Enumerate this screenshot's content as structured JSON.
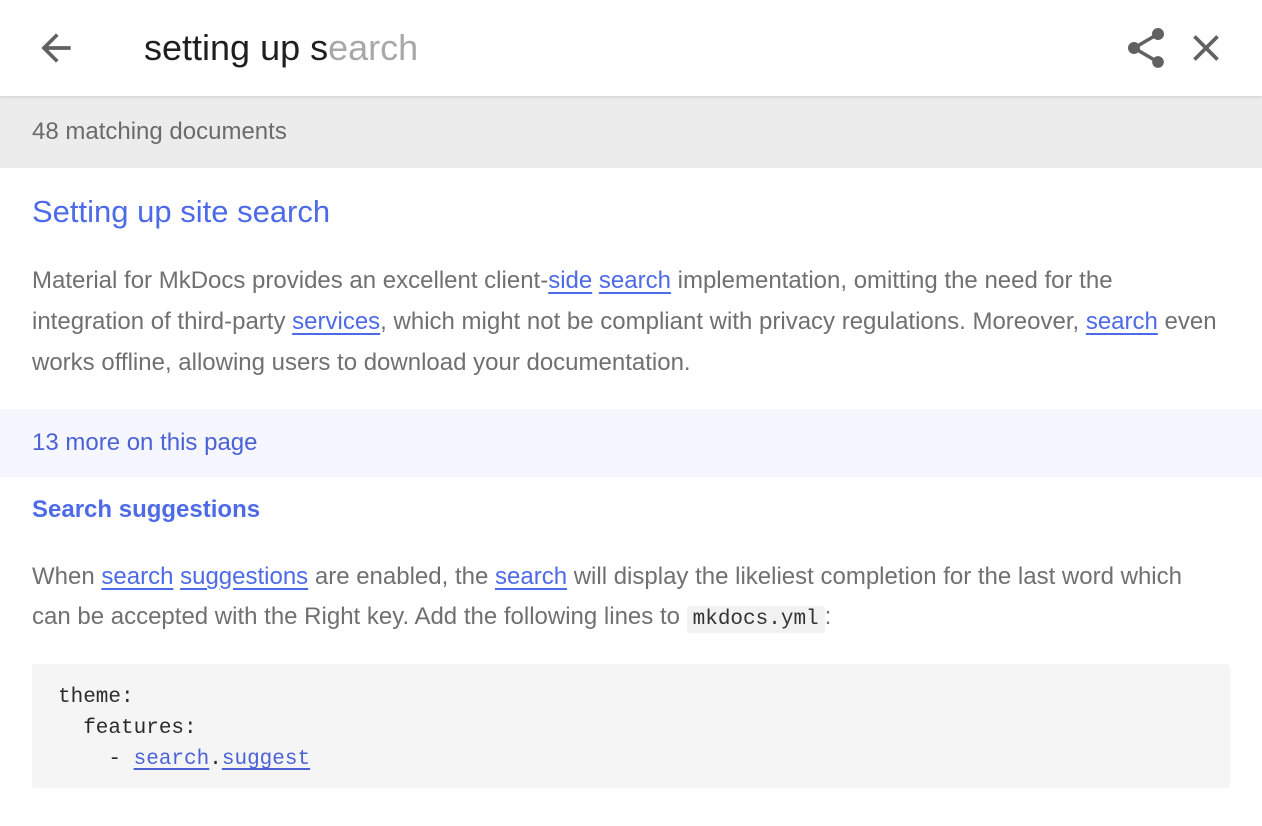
{
  "header": {
    "search_typed": "setting up s",
    "search_suggest_rest": "earch",
    "icons": [
      "arrow-left-icon",
      "share-icon",
      "close-icon"
    ]
  },
  "meta": {
    "text": "48 matching documents"
  },
  "result": {
    "title": "Setting up site search",
    "body_parts": [
      {
        "t": "Material for MkDocs provides an excellent client-",
        "link": false
      },
      {
        "t": "side",
        "link": true
      },
      {
        "t": " ",
        "link": false
      },
      {
        "t": "search",
        "link": true
      },
      {
        "t": " implementation, omitting the need for the integration of third-party ",
        "link": false
      },
      {
        "t": "services",
        "link": true
      },
      {
        "t": ", which might not be compliant with privacy regulations. Moreover, ",
        "link": false
      },
      {
        "t": "search",
        "link": true
      },
      {
        "t": " even works offline, allowing users to download your documentation.",
        "link": false
      }
    ]
  },
  "more": {
    "label": "13 more on this page"
  },
  "section": {
    "title": "Search suggestions",
    "body_parts": [
      {
        "t": "When ",
        "link": false
      },
      {
        "t": "search",
        "link": true
      },
      {
        "t": " ",
        "link": false
      },
      {
        "t": "suggestions",
        "link": true
      },
      {
        "t": " are enabled, the ",
        "link": false
      },
      {
        "t": "search",
        "link": true
      },
      {
        "t": " will display the likeliest completion for the last word which can be accepted with the Right key. Add the following lines to ",
        "link": false
      },
      {
        "t": "mkdocs.yml",
        "code": true
      },
      {
        "t": ":",
        "link": false
      }
    ],
    "code": {
      "line1": "theme:",
      "line2": "  features:",
      "line3_prefix": "    - ",
      "line3_link1": "search",
      "line3_dot": ".",
      "line3_link2": "suggest"
    }
  },
  "colors": {
    "accent": "#4d6ae8",
    "meta_bar_bg": "#ececec",
    "more_bar_bg": "#f6f7fe",
    "code_bg": "#f5f5f5"
  }
}
